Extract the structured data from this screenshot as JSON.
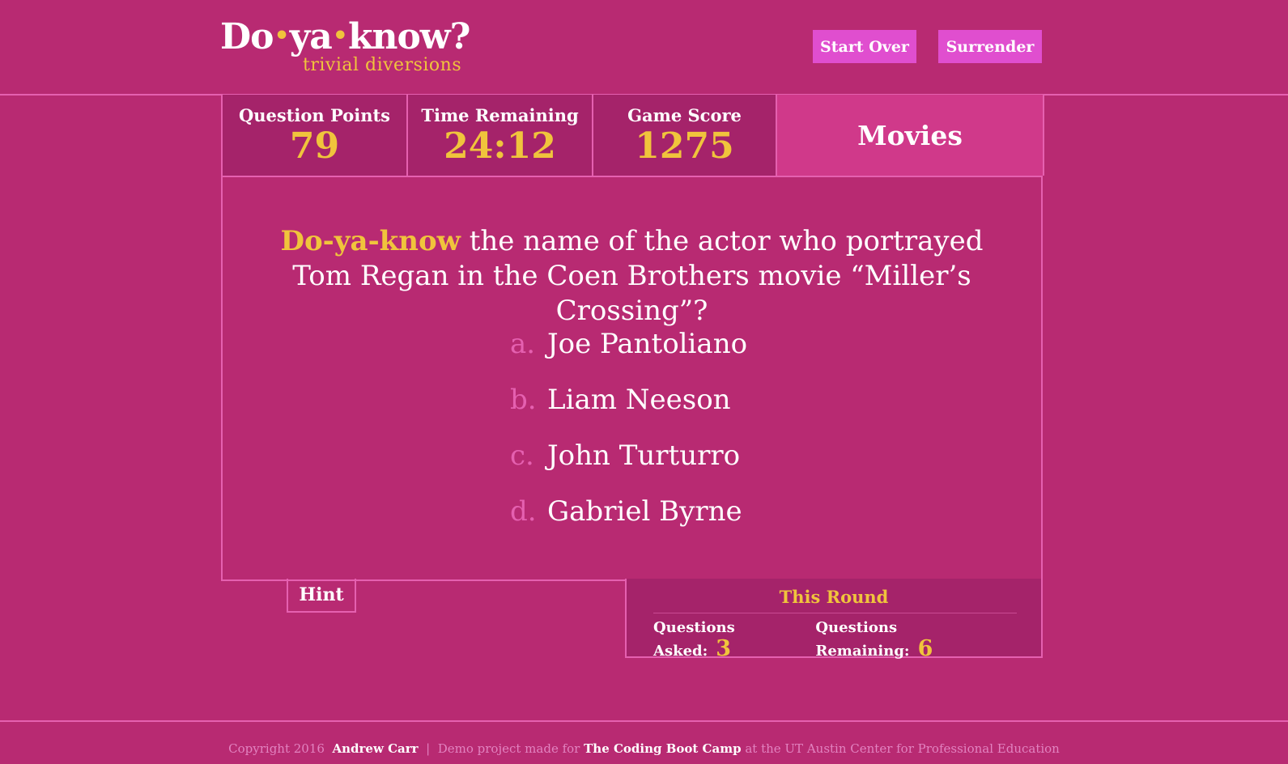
{
  "logo": {
    "word1": "Do",
    "word2": "ya",
    "word3": "know?",
    "tagline": "trivial diversions"
  },
  "header_buttons": {
    "start_over": "Start Over",
    "surrender": "Surrender"
  },
  "stats": {
    "question_points_label": "Question Points",
    "question_points": "79",
    "time_remaining_label": "Time Remaining",
    "time_remaining": "24:12",
    "game_score_label": "Game Score",
    "game_score": "1275",
    "category": "Movies"
  },
  "question": {
    "lead": "Do-ya-know",
    "text": " the name of the actor who portrayed Tom Regan in the Coen Brothers movie “Miller’s Crossing”?"
  },
  "answers": [
    {
      "letter": "a.",
      "text": "Joe Pantoliano"
    },
    {
      "letter": "b.",
      "text": "Liam Neeson"
    },
    {
      "letter": "c.",
      "text": "John Turturro"
    },
    {
      "letter": "d.",
      "text": "Gabriel Byrne"
    }
  ],
  "hint": "Hint",
  "round": {
    "title": "This Round",
    "asked_label": "Questions Asked:",
    "asked": "3",
    "remaining_label": "Questions Remaining:",
    "remaining": "6"
  },
  "footer": {
    "copyright": "Copyright 2016",
    "author": "Andrew Carr",
    "sep": "|",
    "demo": "Demo project made for",
    "bootcamp": "The Coding Boot Camp",
    "location": "at the UT Austin Center for Professional Education"
  },
  "colors": {
    "background": "#b82a72",
    "accent_gold": "#f0c43c",
    "border_pink": "#e560b0",
    "button_pink": "#e04ecf"
  }
}
